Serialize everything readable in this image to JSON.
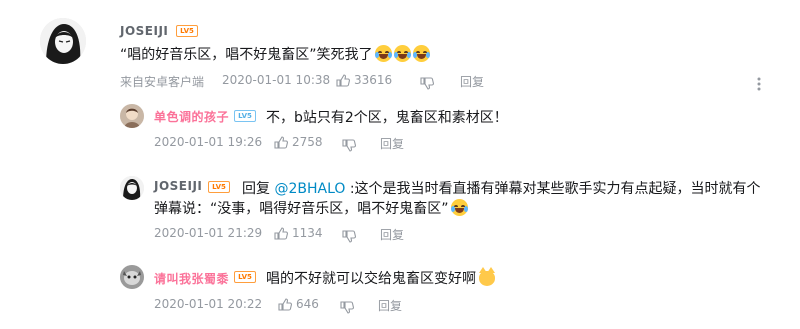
{
  "main": {
    "username": "JOSEIJI",
    "level": "LV5",
    "content": "“唱的好音乐区，唱不好鬼畜区”笑死我了",
    "device": "来自安卓客户端",
    "time": "2020-01-01 10:38",
    "likes": "33616",
    "reply_label": "回复"
  },
  "replies": [
    {
      "username": "单色调的孩子",
      "level": "LV5",
      "content": "不，b站只有2个区，鬼畜区和素材区！",
      "time": "2020-01-01 19:26",
      "likes": "2758",
      "reply_label": "回复"
    },
    {
      "username": "JOSEIJI",
      "level": "LV5",
      "reply_prefix": "回复",
      "mention": "@2BHALO",
      "content_line1": ":这个是我当时看直播有弹幕对某些歌手实力有点起疑，当时就有个",
      "content_line2": "弹幕说：“没事，唱得好音乐区，唱不好鬼畜区”",
      "time": "2020-01-01 21:29",
      "likes": "1134",
      "reply_label": "回复"
    },
    {
      "username": "请叫我张蜀黍",
      "level": "LV5",
      "content": "唱的不好就可以交给鬼畜区变好啊",
      "time": "2020-01-01 20:22",
      "likes": "646",
      "reply_label": "回复"
    }
  ],
  "colors": {
    "vip_name": "#fb7299",
    "mention": "#008ac5",
    "meta": "#9499a0",
    "level_orange": "#ff7a00",
    "level_blue": "#55b0e6"
  },
  "icons": [
    "thumb-up-icon",
    "thumb-down-icon",
    "more-icon",
    "laugh-cry-emoji",
    "cat-emoji"
  ]
}
